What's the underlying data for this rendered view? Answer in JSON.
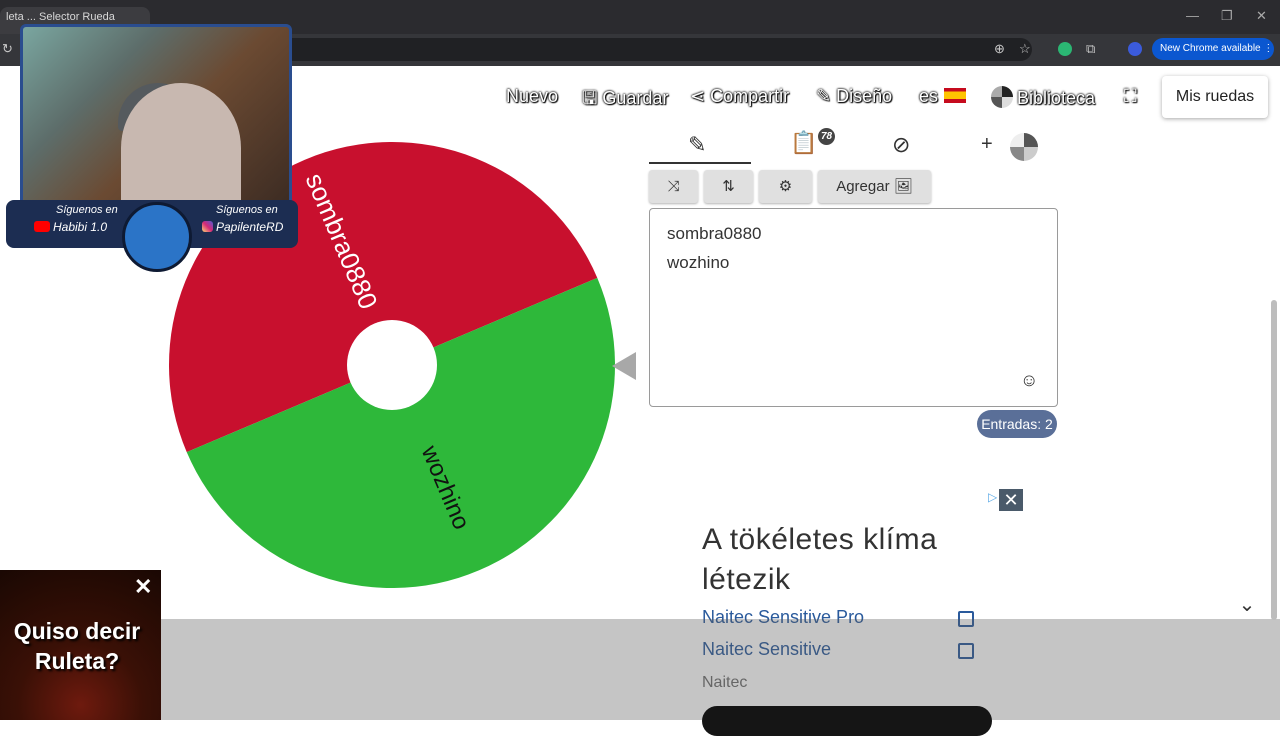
{
  "browser": {
    "tab_title": "leta ... Selector Rueda",
    "new_chrome_label": "New Chrome available",
    "win_minimize": "—",
    "win_restore": "❐",
    "win_close": "✕"
  },
  "toolbar": {
    "nuevo": "Nuevo",
    "guardar": "Guardar",
    "compartir": "Compartir",
    "diseno": "Diseño",
    "language": "es",
    "biblioteca": "Biblioteca",
    "mis_ruedas": "Mis ruedas"
  },
  "panel": {
    "results_badge": "78",
    "agregar_label": "Agregar",
    "entries": [
      "sombra0880",
      "wozhino"
    ],
    "entries_count": "Entradas: 2"
  },
  "wheel": {
    "segments": [
      {
        "label": "sombra0880",
        "color": "#c8102e"
      },
      {
        "label": "wozhino",
        "color": "#2eb83a"
      }
    ]
  },
  "ad": {
    "title": "A tökéletes klíma létezik",
    "link1": "Naitec Sensitive Pro",
    "link2": "Naitec Sensitive",
    "brand": "Naitec"
  },
  "overlay": {
    "follow1": "Síguenos en",
    "channel1": "Habibi 1.0",
    "follow2": "Síguenos en",
    "channel2": "PapilenteRD",
    "roulette_text": "Quiso decir Ruleta?"
  },
  "colors": {
    "accent": "#5a6f98",
    "wheel_red": "#c8102e",
    "wheel_green": "#2eb83a",
    "new_chrome_blue": "#0b57d0"
  }
}
